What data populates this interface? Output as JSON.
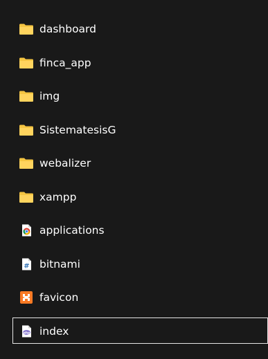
{
  "files": [
    {
      "label": "dashboard",
      "icon": "folder-icon",
      "type": "folder"
    },
    {
      "label": "finca_app",
      "icon": "folder-icon",
      "type": "folder"
    },
    {
      "label": "img",
      "icon": "folder-icon",
      "type": "folder"
    },
    {
      "label": "SistematesisG",
      "icon": "folder-icon",
      "type": "folder"
    },
    {
      "label": "webalizer",
      "icon": "folder-icon",
      "type": "folder"
    },
    {
      "label": "xampp",
      "icon": "folder-icon",
      "type": "folder"
    },
    {
      "label": "applications",
      "icon": "chrome-html-icon",
      "type": "file"
    },
    {
      "label": "bitnami",
      "icon": "css-file-icon",
      "type": "file"
    },
    {
      "label": "favicon",
      "icon": "xampp-favicon-icon",
      "type": "file"
    },
    {
      "label": "index",
      "icon": "php-file-icon",
      "type": "file",
      "selected": true
    }
  ],
  "colors": {
    "background": "#191919",
    "folder": "#f5c542",
    "text": "#ffffff",
    "selection_border": "#e6e6e6"
  }
}
